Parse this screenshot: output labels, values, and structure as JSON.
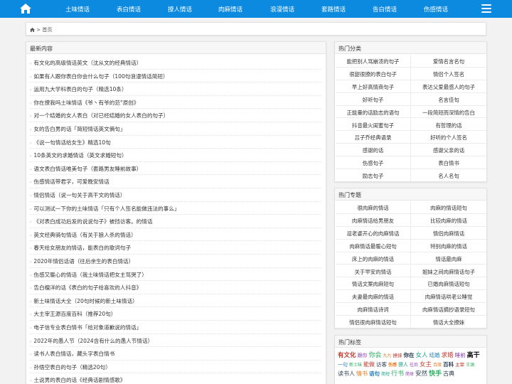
{
  "nav": {
    "items": [
      "土味情话",
      "表白情话",
      "撩人情话",
      "肉麻情话",
      "浪漫情话",
      "套路情话",
      "告白情话",
      "伤感情话"
    ]
  },
  "breadcrumb": {
    "home": "首页",
    "separator": ">"
  },
  "latest": {
    "title": "最新内容",
    "items": [
      "有文化的高级情话英文（沈从文的经典情话）",
      "如果有人跟你表白你会什么句子（100句浪漫情话简短）",
      "运用九大学科表白的句子（精选10条）",
      "你在撩我吗土味情话《爷丶有爷的范°原创》",
      "对一个结婚的女人表白（对已经结婚的女人表白的句子）",
      "女的告白男的话「简短情话英文俩句」",
      "《说一句情话给女生》精选10句",
      "10条英文的求婚情话（英文求婚短句）",
      "语文表白情话唯美句子（套路男友睡前故事）",
      "伤感情话带君字，可爱晚安情话",
      "情侣情话（说一句关于高干文的情话）",
      "可以测试一下你的土味情话「只有个人签名能做违法的事么」",
      "《对表白成功后发的说说句子》被挡访客。的情话",
      "英文经典骑句情话（有关于狼人杀的情话）",
      "春天给女朋友的情话，能表白的歌词句子",
      "2020年情侣话语（往后余生的表白情话）",
      "伤感又暖心的情话（我土味情话把女主骂哭了）",
      "告白檀洋的话《表白的句子给喜欢的人抖音》",
      "新土味情话大全（20句时候的新土味情话）",
      "大主宰王源百度百科（推荐20句）",
      "电子信专业表白情书「给对象道歉说的情话」",
      "2022年的愚人节（2024含有什么的愚人节情话）",
      "读书人表白情话，藏头字表白情书",
      "孙悟空表白的句子（精选20句）",
      "土说男的表白的话《经典话剧情感歌》"
    ]
  },
  "categories": {
    "title": "热门分类",
    "items": [
      "能把别人骂崩溃的句子",
      "爱情名言名句",
      "很甜很撩的表白句子",
      "情侣个人签名",
      "早上好高情商句子",
      "表达父爱最感人的句子",
      "好听句子",
      "名言佳句",
      "正能量的话励志的语句",
      "一段简短而深情的告白",
      "抖音最火闺蜜句子",
      "有哲理的话",
      "吕子乔经典语录",
      "好听的个人签名",
      "感谢的话",
      "感谢父亲的话",
      "伤感句子",
      "表白情书",
      "励志句子",
      "名人名句"
    ]
  },
  "topics": {
    "title": "热门专题",
    "items": [
      "很肉麻的情话",
      "肉麻的情话短句",
      "肉麻情话给男朋友",
      "比较肉麻的情话",
      "逗老婆开心的肉麻情话",
      "情侣肉麻情话",
      "肉麻情话最暖心短句",
      "特别肉麻的情话",
      "床上的肉麻的情话",
      "情话最肉麻",
      "关于早安的情话",
      "姐妹之间肉麻情话句子",
      "情话文案肉麻短句",
      "已婚肉麻情话短句",
      "夫妻最肉麻的情话",
      "肉麻情话哄老公睡觉",
      "肉麻情话诗词",
      "肉麻情话摘抄语录短句",
      "情侣很肉麻情话短句",
      "情话大全撩妹"
    ]
  },
  "tags": {
    "title": "热门标签",
    "items": [
      {
        "t": "有文化",
        "c": "#c0392b"
      },
      {
        "t": "跟你",
        "c": "#8e44ad"
      },
      {
        "t": "你会",
        "c": "#27ae60"
      },
      {
        "t": "九九",
        "c": "#e67e22"
      },
      {
        "t": "撩妹",
        "c": "#c0392b"
      },
      {
        "t": "你在",
        "c": "#2c3e50"
      },
      {
        "t": "女人",
        "c": "#16a085"
      },
      {
        "t": "结婚",
        "c": "#2980b9"
      },
      {
        "t": "求婚",
        "c": "#c0392b"
      },
      {
        "t": "睡前",
        "c": "#8e44ad"
      },
      {
        "t": "高干",
        "c": "#000000"
      },
      {
        "t": "一句",
        "c": "#2980b9"
      },
      {
        "t": "新土味",
        "c": "#27ae60"
      },
      {
        "t": "能做",
        "c": "#c0392b"
      },
      {
        "t": "访客",
        "c": "#2c3e50"
      },
      {
        "t": "伤感",
        "c": "#e67e22"
      },
      {
        "t": "撩人",
        "c": "#16a085"
      },
      {
        "t": "往后",
        "c": "#8e44ad"
      },
      {
        "t": "女主",
        "c": "#c0392b"
      },
      {
        "t": "百度",
        "c": "#e67e22"
      },
      {
        "t": "百科",
        "c": "#2c3e50"
      },
      {
        "t": "主宰",
        "c": "#c0392b"
      },
      {
        "t": "王源",
        "c": "#27ae60"
      },
      {
        "t": "读书人",
        "c": "#2c3e50"
      },
      {
        "t": "情书",
        "c": "#e67e22"
      },
      {
        "t": "语句",
        "c": "#2980b9"
      },
      {
        "t": "简短",
        "c": "#16a085"
      },
      {
        "t": "行书",
        "c": "#27ae60"
      },
      {
        "t": "简体",
        "c": "#8e44ad"
      },
      {
        "t": "安然",
        "c": "#2c3e50"
      },
      {
        "t": "快手",
        "c": "#27ae60"
      },
      {
        "t": "古典",
        "c": "#2c3e50"
      }
    ]
  }
}
